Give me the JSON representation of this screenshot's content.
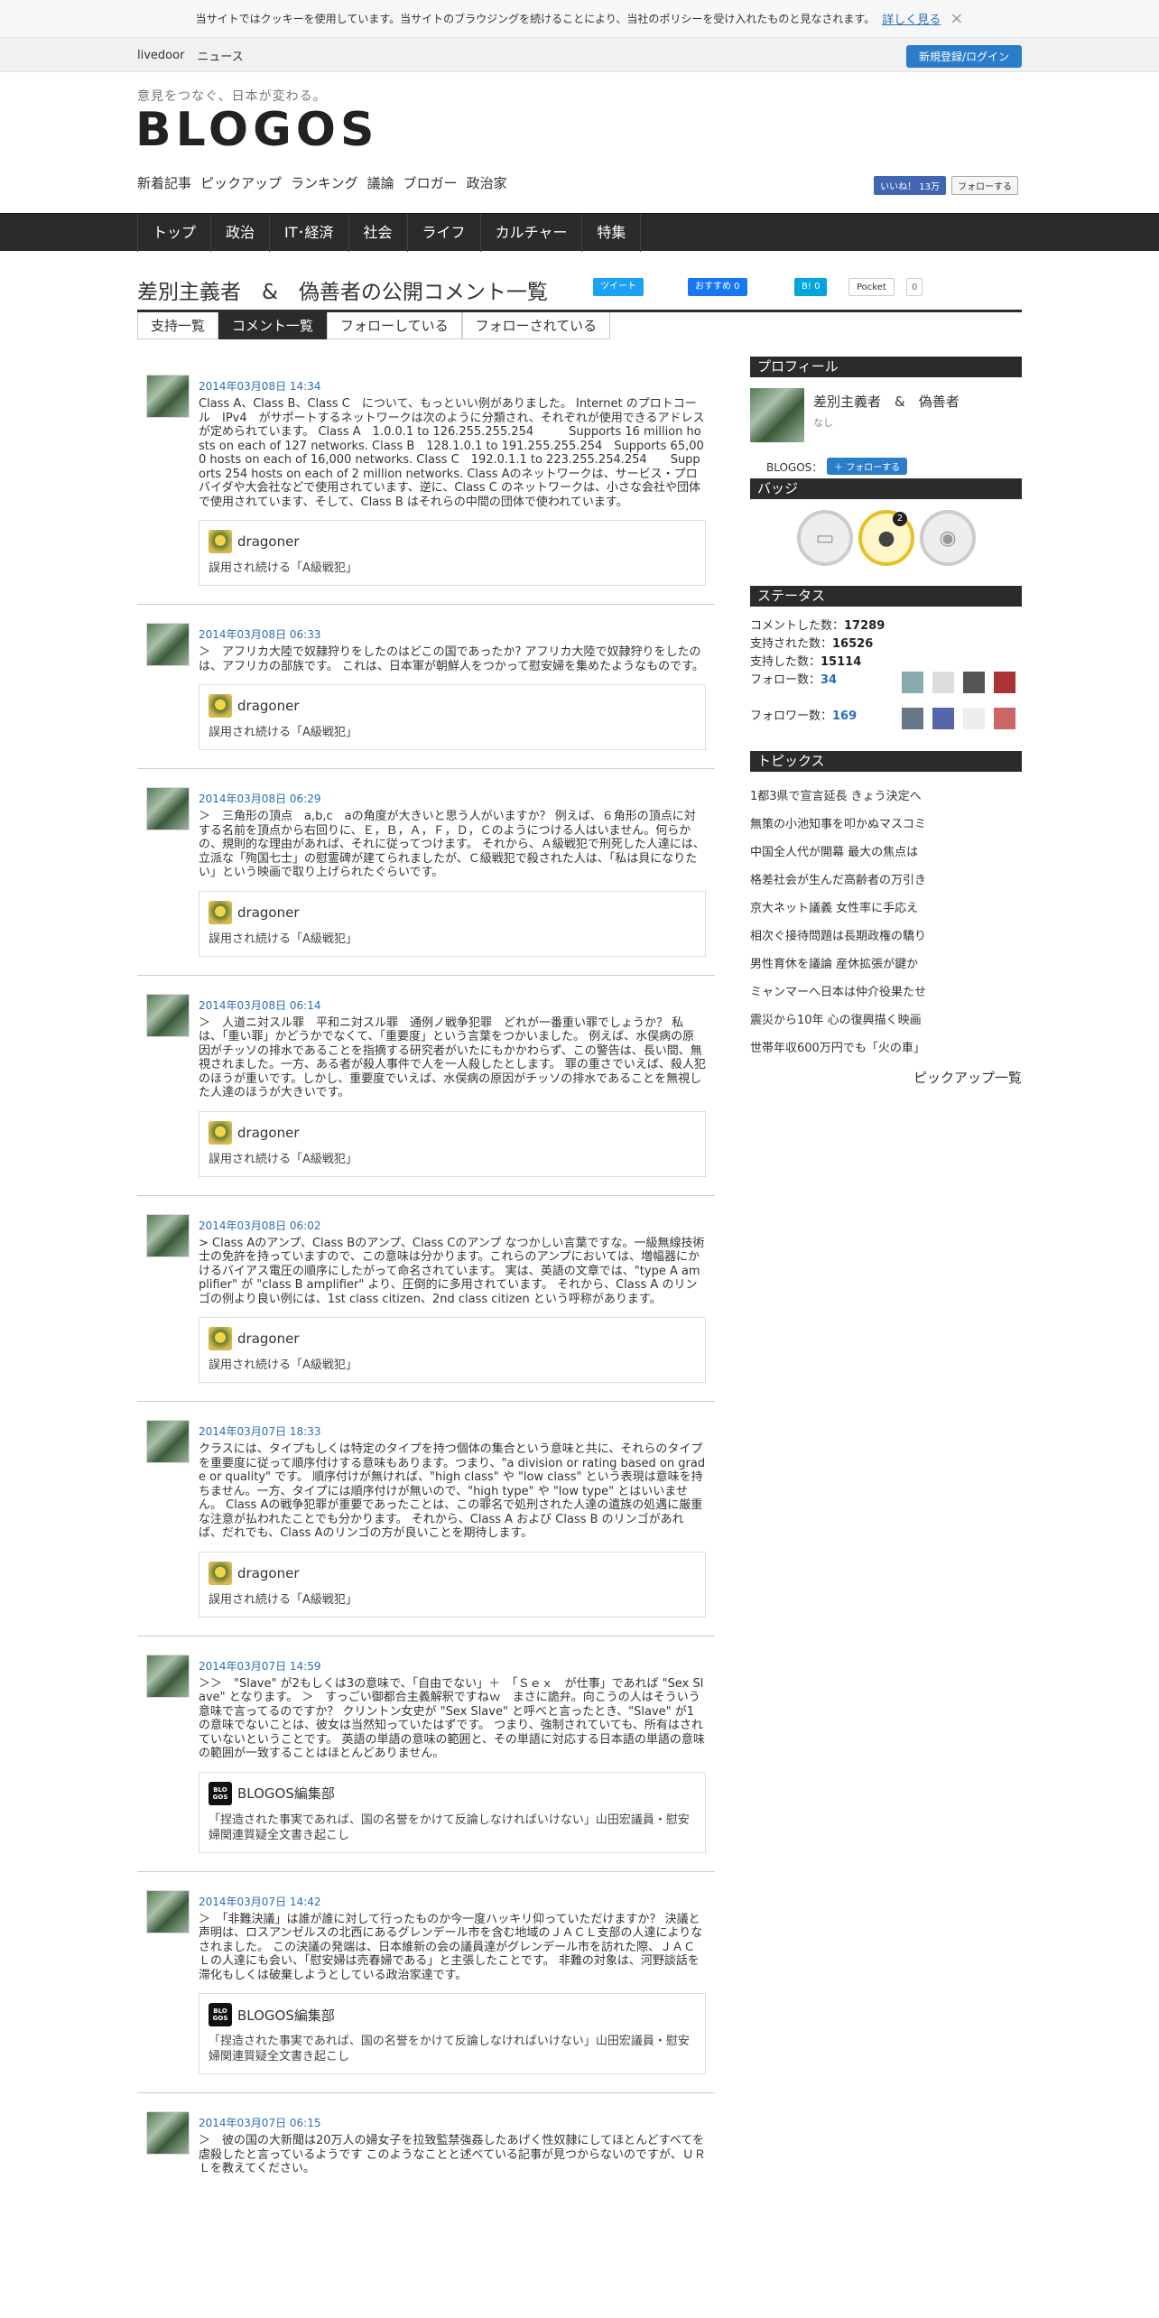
{
  "cookie": {
    "text": "当サイトではクッキーを使用しています。当サイトのブラウジングを続けることにより、当社のポリシーを受け入れたものと見なされます。",
    "more": "詳しく見る",
    "close": "×"
  },
  "topbar": {
    "livedoor": "livedoor",
    "news": "ニュース",
    "register": "新規登録/ログイン"
  },
  "header": {
    "tagline": "意見をつなぐ、日本が変わる。",
    "logo": "BLOGOS",
    "subnav": [
      "新着記事",
      "ピックアップ",
      "ランキング",
      "議論",
      "ブロガー",
      "政治家"
    ],
    "like": "いいね！ 13万",
    "follow_tw": "フォローする"
  },
  "mainnav": [
    "トップ",
    "政治",
    "IT･経済",
    "社会",
    "ライフ",
    "カルチャー",
    "特集"
  ],
  "page": {
    "title": "差別主義者　&　偽善者の公開コメント一覧",
    "tweet": "ツイート",
    "fb": "おすすめ 0",
    "hatena": "0",
    "pocket": "Pocket",
    "pocket_count": "0"
  },
  "tabs": [
    "支持一覧",
    "コメント一覧",
    "フォローしている",
    "フォローされている"
  ],
  "entries": [
    {
      "date": "2014年03月08日 14:34",
      "text": "Class A、Class B、Class C　について、もっといい例がありました。 Internet のプロトコール　IPv4　がサポートするネットワークは次のように分類され、それぞれが使用できるアドレスが定められています。 Class A　1.0.0.1 to 126.255.255.254　　　Supports 16 million hosts on each of 127 networks. Class B　128.1.0.1 to 191.255.255.254　Supports 65,000 hosts on each of 16,000 networks. Class C　192.0.1.1 to 223.255.254.254　　Supports 254 hosts on each of 2 million networks. Class Aのネットワークは、サービス・プロバイダや大会社などで使用されています、逆に、Class C のネットワークは、小さな会社や団体で使用されています、そして、Class B はそれらの中間の団体で使われています。",
      "author": "dragoner",
      "title": "誤用され続ける「A級戦犯」"
    },
    {
      "date": "2014年03月08日 06:33",
      "text": "＞　アフリカ大陸で奴隷狩りをしたのはどこの国であったか? アフリカ大陸で奴隷狩りをしたのは、アフリカの部族です。 これは、日本軍が朝鮮人をつかって慰安婦を集めたようなものです。",
      "author": "dragoner",
      "title": "誤用され続ける「A級戦犯」"
    },
    {
      "date": "2014年03月08日 06:29",
      "text": "＞　三角形の頂点　a,b,c　aの角度が大きいと思う人がいますか？ 例えば、６角形の頂点に対する名前を頂点から右回りに、Ｅ，Ｂ，Ａ，Ｆ，Ｄ，Ｃのようにつける人はいません。何らかの、規則的な理由があれば、それに従ってつけます。 それから、Ａ級戦犯で刑死した人達には、立派な「殉国七士」の慰霊碑が建てられましたが、Ｃ級戦犯で殺された人は、「私は貝になりたい」という映画で取り上げられたぐらいです。",
      "author": "dragoner",
      "title": "誤用され続ける「A級戦犯」"
    },
    {
      "date": "2014年03月08日 06:14",
      "text": "＞　人道ニ対スル罪　平和ニ対スル罪　通例ノ戦争犯罪　どれが一番重い罪でしょうか？ 私は、「重い罪」かどうかでなくて、「重要度」という言葉をつかいました。 例えば、水俣病の原因がチッソの排水であることを指摘する研究者がいたにもかかわらず、この警告は、長い間、無視されました。一方、ある者が殺人事件で人を一人殺したとします。 罪の重さでいえば、殺人犯のほうが重いです。しかし、重要度でいえば、水俣病の原因がチッソの排水であることを無視した人達のほうが大きいです。",
      "author": "dragoner",
      "title": "誤用され続ける「A級戦犯」"
    },
    {
      "date": "2014年03月08日 06:02",
      "text": "> Class Aのアンプ、Class Bのアンプ、Class Cのアンプ なつかしい言葉ですな。一級無線技術士の免許を持っていますので、この意味は分かります。これらのアンプにおいては、増幅器にかけるバイアス電圧の順序にしたがって命名されています。 実は、英語の文章では、\"type A amplifier\" が \"class B amplifier\" より、圧倒的に多用されています。 それから、Class A のリンゴの例より良い例には、1st class citizen、2nd class citizen という呼称があります。",
      "author": "dragoner",
      "title": "誤用され続ける「A級戦犯」"
    },
    {
      "date": "2014年03月07日 18:33",
      "text": "クラスには、タイプもしくは特定のタイプを持つ個体の集合という意味と共に、それらのタイプを重要度に従って順序付けする意味もあります。つまり、\"a division or rating based on grade or quality\" です。 順序付けが無ければ、\"high class\" や \"low class\" という表現は意味を持ちません。一方、タイプには順序付けが無いので、\"high type\" や \"low type\" とはいいません。 Class Aの戦争犯罪が重要であったことは、この罪名で処刑された人達の遺族の処遇に厳重な注意が払われたことでも分かります。 それから、Class A および Class B のリンゴがあれば、だれでも、Class Aのリンゴの方が良いことを期待します。",
      "author": "dragoner",
      "title": "誤用され続ける「A級戦犯」"
    },
    {
      "date": "2014年03月07日 14:59",
      "text": "＞＞　\"Slave\" が2もしくは3の意味で、「自由でない」＋　「Ｓｅｘ　が仕事」であれば \"Sex Slave\" となります。 ＞　すっごい御都合主義解釈ですねｗ　まさに詭弁。向こうの人はそういう意味で言ってるのですか？ クリントン女史が \"Sex Slave\" と呼べと言ったとき、\"Slave\" が1の意味でないことは、彼女は当然知っていたはずです。 つまり、強制されていても、所有はされていないということです。 英語の単語の意味の範囲と、その単語に対応する日本語の単語の意味の範囲が一致することはほとんどありません。",
      "author": "BLOGOS編集部",
      "title": "「捏造された事実であれば、国の名誉をかけて反論しなければいけない」山田宏議員・慰安婦関連質疑全文書き起こし",
      "blogos": true
    },
    {
      "date": "2014年03月07日 14:42",
      "text": "＞　「非難決議」は誰が誰に対して行ったものか今一度ハッキリ仰っていただけますか？ 決議と声明は、ロスアンゼルスの北西にあるグレンデール市を含む地域のＪＡＣＬ支部の人達によりなされました。 この決議の発端は、日本維新の会の議員達がグレンデール市を訪れた際、ＪＡＣＬの人達にも会い、「慰安婦は売春婦である」と主張したことです。 非難の対象は、河野談話を滞化もしくは破棄しようとしている政治家達です。",
      "author": "BLOGOS編集部",
      "title": "「捏造された事実であれば、国の名誉をかけて反論しなければいけない」山田宏議員・慰安婦関連質疑全文書き起こし",
      "blogos": true
    },
    {
      "date": "2014年03月07日 06:15",
      "text": "＞　彼の国の大新聞は20万人の婦女子を拉致監禁強姦したあげく性奴隷にしてほとんどすべてを虐殺したと言っているようです このようなことと述べている記事が見つからないのですが、ＵＲＬを教えてください。",
      "author": "",
      "title": ""
    }
  ],
  "sidebar": {
    "profile_head": "プロフィール",
    "name": "差別主義者　&　偽善者",
    "none": "なし",
    "blogos_label": "BLOGOS：",
    "follow": "フォローする",
    "badge_head": "バッジ",
    "badge_num": "2",
    "status_head": "ステータス",
    "stats": [
      {
        "label": "コメントした数：",
        "value": "17289"
      },
      {
        "label": "支持された数：",
        "value": "16526"
      },
      {
        "label": "支持した数：",
        "value": "15114"
      },
      {
        "label": "フォロー数：",
        "value": "34"
      },
      {
        "label": "フォロワー数：",
        "value": "169"
      }
    ],
    "topics_head": "トピックス",
    "topics": [
      "1都3県で宣言延長 きょう決定へ",
      "無策の小池知事を叩かぬマスコミ",
      "中国全人代が開幕 最大の焦点は",
      "格差社会が生んだ高齢者の万引き",
      "京大ネット議義 女性率に手応え",
      "相次ぐ接待問題は長期政権の驕り",
      "男性育休を議論 産休拡張が鍵か",
      "ミャンマーへ日本は仲介役果たせ",
      "震災から10年 心の復興描く映画",
      "世帯年収600万円でも「火の車」"
    ],
    "pickup_all": "ピックアップ一覧"
  }
}
